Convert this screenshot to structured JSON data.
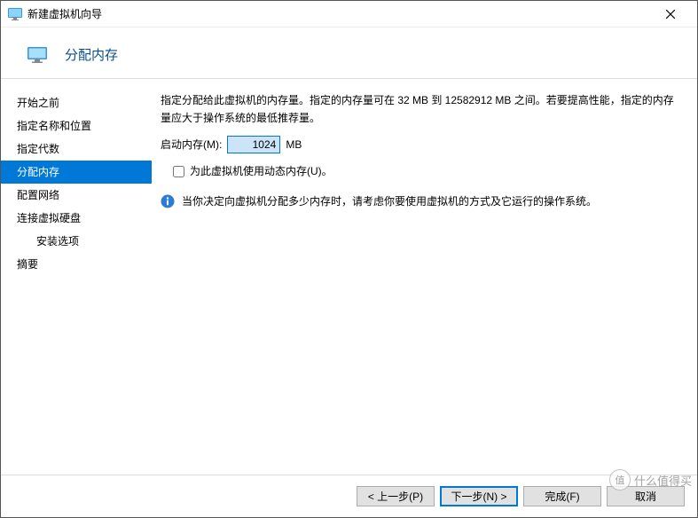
{
  "window": {
    "title": "新建虚拟机向导"
  },
  "header": {
    "title": "分配内存"
  },
  "sidebar": {
    "items": [
      {
        "label": "开始之前"
      },
      {
        "label": "指定名称和位置"
      },
      {
        "label": "指定代数"
      },
      {
        "label": "分配内存"
      },
      {
        "label": "配置网络"
      },
      {
        "label": "连接虚拟硬盘"
      },
      {
        "label": "安装选项"
      },
      {
        "label": "摘要"
      }
    ],
    "selected_index": 3
  },
  "content": {
    "description": "指定分配给此虚拟机的内存量。指定的内存量可在 32 MB 到 12582912 MB 之间。若要提高性能，指定的内存量应大于操作系统的最低推荐量。",
    "memory_label": "启动内存(M):",
    "memory_value": "1024",
    "memory_unit": "MB",
    "dynamic_checkbox_label": "为此虚拟机使用动态内存(U)。",
    "dynamic_checked": false,
    "info_text": "当你决定向虚拟机分配多少内存时，请考虑你要使用虚拟机的方式及它运行的操作系统。"
  },
  "footer": {
    "prev": "< 上一步(P)",
    "next": "下一步(N) >",
    "finish": "完成(F)",
    "cancel": "取消"
  },
  "watermark": {
    "text": "什么值得买"
  }
}
